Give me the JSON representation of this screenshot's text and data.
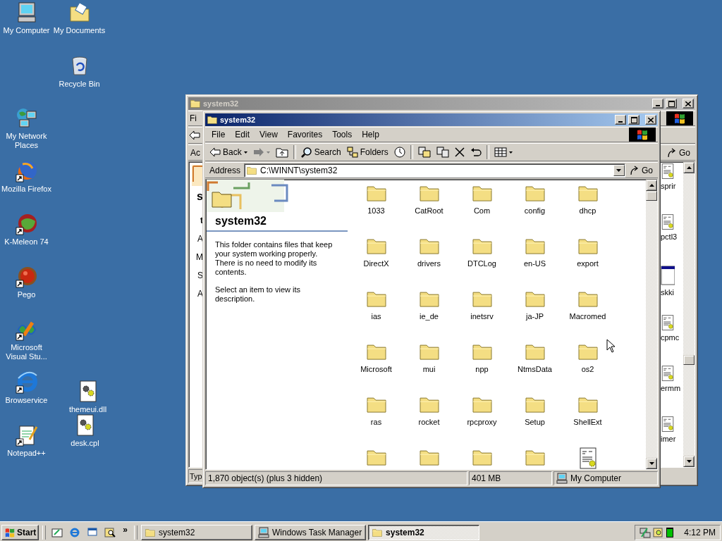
{
  "desktop_icons": [
    {
      "label": "My Computer",
      "shortcut": false
    },
    {
      "label": "My Documents",
      "shortcut": false
    },
    {
      "label": "Recycle Bin",
      "shortcut": false
    },
    {
      "label": "My Network Places",
      "shortcut": false
    },
    {
      "label": "Mozilla Firefox",
      "shortcut": true
    },
    {
      "label": "K-Meleon 74",
      "shortcut": true
    },
    {
      "label": "Pego",
      "shortcut": true
    },
    {
      "label": "Microsoft Visual Stu...",
      "shortcut": true
    },
    {
      "label": "Browservice",
      "shortcut": true
    },
    {
      "label": "themeui.dll",
      "shortcut": false
    },
    {
      "label": "desk.cpl",
      "shortcut": false
    },
    {
      "label": "Notepad++",
      "shortcut": true
    }
  ],
  "back_window": {
    "title": "system32",
    "active": false,
    "menu_fragment": "Fi",
    "address_fragment": "Ac",
    "go": "Go",
    "panel_fragments": [
      {
        "kind": "heading",
        "text": "s"
      },
      {
        "kind": "bold",
        "text": "t"
      },
      {
        "kind": "text",
        "text": "A"
      },
      {
        "kind": "text",
        "text": "M"
      },
      {
        "kind": "text",
        "text": "S"
      },
      {
        "kind": "text",
        "text": "A"
      }
    ],
    "files": [
      "sprir",
      "pctl3",
      "skki",
      "cpmc",
      "ermm",
      "imer"
    ],
    "status_fragment": "Typ"
  },
  "window": {
    "title": "system32",
    "active": true,
    "menu": [
      "File",
      "Edit",
      "View",
      "Favorites",
      "Tools",
      "Help"
    ],
    "toolbar": [
      {
        "kind": "back",
        "label": "Back",
        "disabled": false
      },
      {
        "kind": "forward",
        "disabled": true
      },
      {
        "kind": "up",
        "disabled": false
      },
      {
        "kind": "separator"
      },
      {
        "kind": "search",
        "label": "Search",
        "disabled": false
      },
      {
        "kind": "folders",
        "label": "Folders",
        "disabled": false
      },
      {
        "kind": "history",
        "disabled": false
      },
      {
        "kind": "separator"
      },
      {
        "kind": "move",
        "disabled": false
      },
      {
        "kind": "copy",
        "disabled": false
      },
      {
        "kind": "delete",
        "disabled": false
      },
      {
        "kind": "undo",
        "disabled": false
      },
      {
        "kind": "separator"
      },
      {
        "kind": "views",
        "disabled": false
      }
    ],
    "address": {
      "label": "Address",
      "value": "C:\\WINNT\\system32",
      "go": "Go"
    },
    "info_pane": {
      "title": "system32",
      "description": "This folder contains files that keep your system working properly. There is no need to modify its contents.",
      "hint": "Select an item to view its description."
    },
    "files": [
      {
        "kind": "folder",
        "label": "1033"
      },
      {
        "kind": "folder",
        "label": "CatRoot"
      },
      {
        "kind": "folder",
        "label": "Com"
      },
      {
        "kind": "folder",
        "label": "config"
      },
      {
        "kind": "folder",
        "label": "dhcp"
      },
      {
        "kind": "folder",
        "label": "DirectX"
      },
      {
        "kind": "folder",
        "label": "drivers"
      },
      {
        "kind": "folder",
        "label": "DTCLog"
      },
      {
        "kind": "folder",
        "label": "en-US"
      },
      {
        "kind": "folder",
        "label": "export"
      },
      {
        "kind": "folder",
        "label": "ias"
      },
      {
        "kind": "folder",
        "label": "ie_de"
      },
      {
        "kind": "folder",
        "label": "inetsrv"
      },
      {
        "kind": "folder",
        "label": "ja-JP"
      },
      {
        "kind": "folder",
        "label": "Macromed"
      },
      {
        "kind": "folder",
        "label": "Microsoft"
      },
      {
        "kind": "folder",
        "label": "mui"
      },
      {
        "kind": "folder",
        "label": "npp"
      },
      {
        "kind": "folder",
        "label": "NtmsData"
      },
      {
        "kind": "folder",
        "label": "os2"
      },
      {
        "kind": "folder",
        "label": "ras"
      },
      {
        "kind": "folder",
        "label": "rocket"
      },
      {
        "kind": "folder",
        "label": "rpcproxy"
      },
      {
        "kind": "folder",
        "label": "Setup"
      },
      {
        "kind": "folder",
        "label": "ShellExt"
      },
      {
        "kind": "folder"
      },
      {
        "kind": "folder"
      },
      {
        "kind": "folder"
      },
      {
        "kind": "folder"
      },
      {
        "kind": "file"
      }
    ],
    "status_bar": {
      "objects": "1,870 object(s) (plus 3 hidden)",
      "size": "401 MB",
      "zone": "My Computer"
    }
  },
  "taskbar": {
    "start": "Start",
    "chevron": "»",
    "tasks": [
      {
        "label": "system32",
        "kind": "folder",
        "selected": false
      },
      {
        "label": "Windows Task Manager",
        "kind": "app",
        "selected": false
      },
      {
        "label": "system32",
        "kind": "folder",
        "selected": true
      }
    ],
    "clock": "4:12 PM"
  }
}
